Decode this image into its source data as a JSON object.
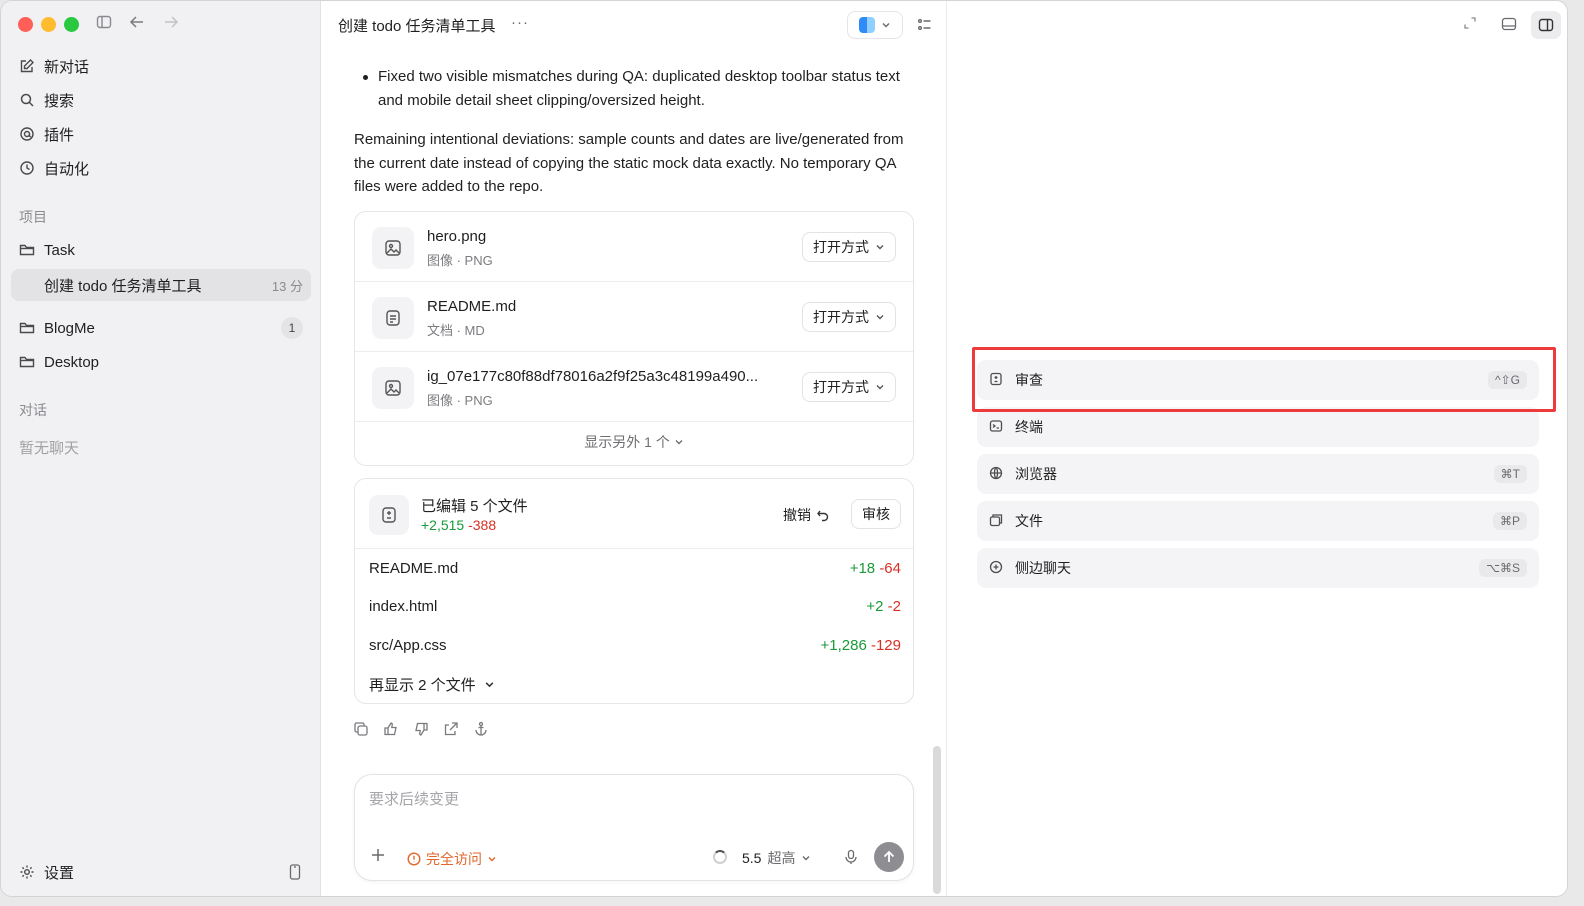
{
  "sidebar": {
    "nav": [
      {
        "label": "新对话",
        "icon": "new-chat-icon"
      },
      {
        "label": "搜索",
        "icon": "search-icon"
      },
      {
        "label": "插件",
        "icon": "plugin-icon"
      },
      {
        "label": "自动化",
        "icon": "clock-icon"
      }
    ],
    "projects_label": "项目",
    "projects": [
      {
        "label": "Task"
      },
      {
        "label": "创建 todo 任务清单工具",
        "meta": "13 分"
      },
      {
        "label": "BlogMe",
        "badge": "1"
      },
      {
        "label": "Desktop"
      }
    ],
    "chats_label": "对话",
    "no_chats": "暂无聊天",
    "settings": "设置"
  },
  "main": {
    "title": "创建 todo 任务清单工具",
    "more": "···",
    "bullet": "Fixed two visible mismatches during QA: duplicated desktop toolbar status text and mobile detail sheet clipping/oversized height.",
    "paragraph": "Remaining intentional deviations: sample counts and dates are live/generated from the current date instead of copying the static mock data exactly. No temporary QA files were added to the repo.",
    "files": [
      {
        "name": "hero.png",
        "type": "图像 · PNG",
        "icon": "image-icon"
      },
      {
        "name": "README.md",
        "type": "文档 · MD",
        "icon": "document-icon"
      },
      {
        "name": "ig_07e177c80f88df78016a2f9f25a3c48199a490...",
        "type": "图像 · PNG",
        "icon": "image-icon"
      }
    ],
    "open_with": "打开方式",
    "show_more_files": "显示另外 1 个",
    "edits": {
      "title": "已编辑 5 个文件",
      "added": "+2,515",
      "removed": "-388",
      "undo": "撤销",
      "review": "审核",
      "rows": [
        {
          "file": "README.md",
          "added": "+18",
          "removed": "-64"
        },
        {
          "file": "index.html",
          "added": "+2",
          "removed": "-2"
        },
        {
          "file": "src/App.css",
          "added": "+1,286",
          "removed": "-129"
        }
      ],
      "more": "再显示 2 个文件"
    },
    "composer": {
      "placeholder": "要求后续变更",
      "access": "完全访问",
      "model": "5.5",
      "level": "超高"
    }
  },
  "right_panel": {
    "items": [
      {
        "label": "审查",
        "shortcut": "^⇧G",
        "icon": "diff-icon"
      },
      {
        "label": "终端",
        "shortcut": "",
        "icon": "terminal-icon"
      },
      {
        "label": "浏览器",
        "shortcut": "⌘T",
        "icon": "globe-icon"
      },
      {
        "label": "文件",
        "shortcut": "⌘P",
        "icon": "files-icon"
      },
      {
        "label": "侧边聊天",
        "shortcut": "⌥⌘S",
        "icon": "plus-circle-icon"
      }
    ]
  }
}
